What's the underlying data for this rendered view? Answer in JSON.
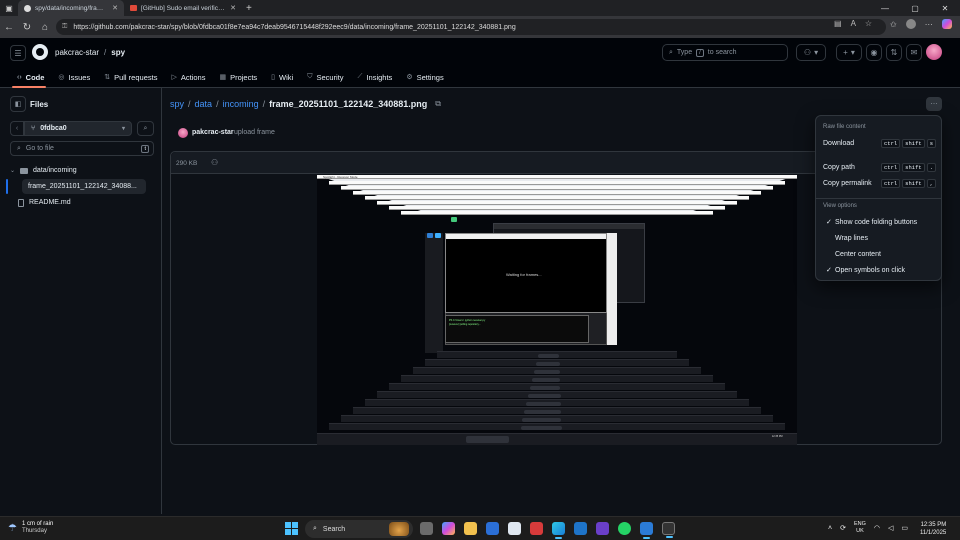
{
  "browser": {
    "tabs": [
      {
        "title": "spy/data/incoming/frame_20251101_122142_340881.png",
        "active": true
      },
      {
        "title": "[GitHub] Sudo email verification code",
        "active": false
      }
    ],
    "url": "https://github.com/pakcrac-star/spy/blob/0fdbca01f8e7ea94c7deab9546715448f292eec9/data/incoming/frame_20251101_122142_340881.png"
  },
  "header": {
    "owner": "pakcrac-star",
    "separator": "/",
    "repo": "spy",
    "search_placeholder": "Type",
    "search_key": "/",
    "search_suffix": "to search",
    "plus": "+"
  },
  "reponav": [
    {
      "label": "Code",
      "icon": "code-icon"
    },
    {
      "label": "Issues",
      "icon": "issue-icon"
    },
    {
      "label": "Pull requests",
      "icon": "pull-request-icon"
    },
    {
      "label": "Actions",
      "icon": "play-icon"
    },
    {
      "label": "Projects",
      "icon": "table-icon"
    },
    {
      "label": "Wiki",
      "icon": "book-icon"
    },
    {
      "label": "Security",
      "icon": "shield-icon"
    },
    {
      "label": "Insights",
      "icon": "graph-icon"
    },
    {
      "label": "Settings",
      "icon": "gear-icon"
    }
  ],
  "sidebar": {
    "title": "Files",
    "branch": "0fdbca0",
    "goto_placeholder": "Go to file",
    "goto_key": "t",
    "tree": [
      {
        "label": "data/incoming",
        "type": "folder"
      },
      {
        "label": "frame_20251101_122142_34088...",
        "type": "file",
        "selected": true
      },
      {
        "label": "README.md",
        "type": "file"
      }
    ]
  },
  "breadcrumb": {
    "repo": "spy",
    "dir1": "data",
    "dir2": "incoming",
    "file": "frame_20251101_122142_340881.png",
    "sep": "/"
  },
  "commit": {
    "author": "pakcrac-star",
    "message": "upload frame"
  },
  "file": {
    "size": "290 KB"
  },
  "embedded": {
    "window_title": "Spotlight - Receiver Mode",
    "waiting": "Waiting for frames...",
    "terminal_lines": [
      "PS C:\\Users> python receiver.py",
      "[receiver] polling repository..."
    ],
    "clock_time": "12:35 PM",
    "clock_date": "11/1/2025",
    "search": "Search"
  },
  "menu": {
    "head1": "Raw file content",
    "download": "Download",
    "download_keys": [
      "ctrl",
      "shift",
      "s"
    ],
    "copy_path": "Copy path",
    "copy_path_keys": [
      "ctrl",
      "shift",
      "."
    ],
    "copy_permalink": "Copy permalink",
    "copy_permalink_keys": [
      "ctrl",
      "shift",
      ","
    ],
    "head2": "View options",
    "opt1": "Show code folding buttons",
    "opt2": "Wrap lines",
    "opt3": "Center content",
    "opt4": "Open symbols on click"
  },
  "taskbar": {
    "weather_line1": "1 cm of rain",
    "weather_line2": "Thursday",
    "search": "Search",
    "lang1": "ENG",
    "lang2": "UK",
    "time": "12:35 PM",
    "date": "11/1/2025"
  },
  "colors": {
    "accent_blue": "#4493f8",
    "nav_underline": "#f78166",
    "bg": "#0d1117"
  }
}
